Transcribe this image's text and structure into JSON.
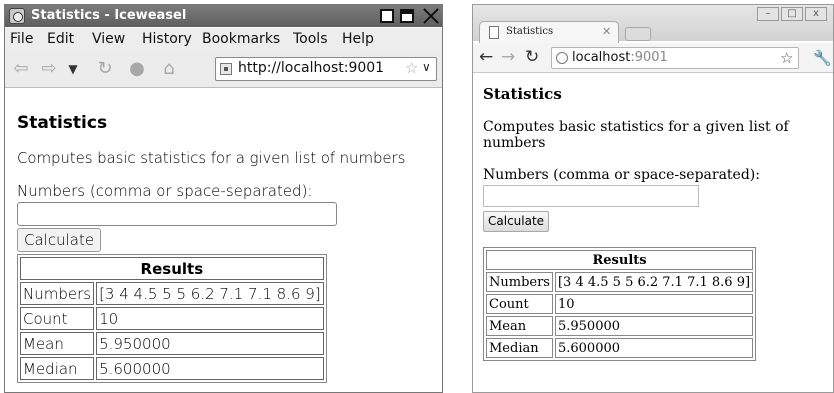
{
  "left": {
    "window_title": "Statistics - Iceweasel",
    "menu": [
      "File",
      "Edit",
      "View",
      "History",
      "Bookmarks",
      "Tools",
      "Help"
    ],
    "url": "http://localhost:9001",
    "page": {
      "heading": "Statistics",
      "description": "Computes basic statistics for a given list of numbers",
      "input_label": "Numbers (comma or space-separated):",
      "input_value": "",
      "button": "Calculate",
      "table": {
        "header": "Results",
        "rows": [
          {
            "label": "Numbers",
            "value": "[3 4 4.5 5 5 6.2 7.1 7.1 8.6 9]"
          },
          {
            "label": "Count",
            "value": "10"
          },
          {
            "label": "Mean",
            "value": "5.950000"
          },
          {
            "label": "Median",
            "value": "5.600000"
          }
        ]
      }
    }
  },
  "right": {
    "tab_title": "Statistics",
    "url_host": "localhost",
    "url_port": ":9001",
    "page": {
      "heading": "Statistics",
      "description": "Computes basic statistics for a given list of numbers",
      "input_label": "Numbers (comma or space-separated):",
      "input_value": "",
      "button": "Calculate",
      "table": {
        "header": "Results",
        "rows": [
          {
            "label": "Numbers",
            "value": "[3 4 4.5 5 5 6.2 7.1 7.1 8.6 9]"
          },
          {
            "label": "Count",
            "value": "10"
          },
          {
            "label": "Mean",
            "value": "5.950000"
          },
          {
            "label": "Median",
            "value": "5.600000"
          }
        ]
      }
    }
  },
  "icons": {
    "back": "back-arrow-icon",
    "forward": "forward-arrow-icon",
    "reload": "reload-icon",
    "stop": "stop-icon",
    "home": "home-icon",
    "bookmark_star": "star-icon",
    "settings": "wrench-icon"
  }
}
